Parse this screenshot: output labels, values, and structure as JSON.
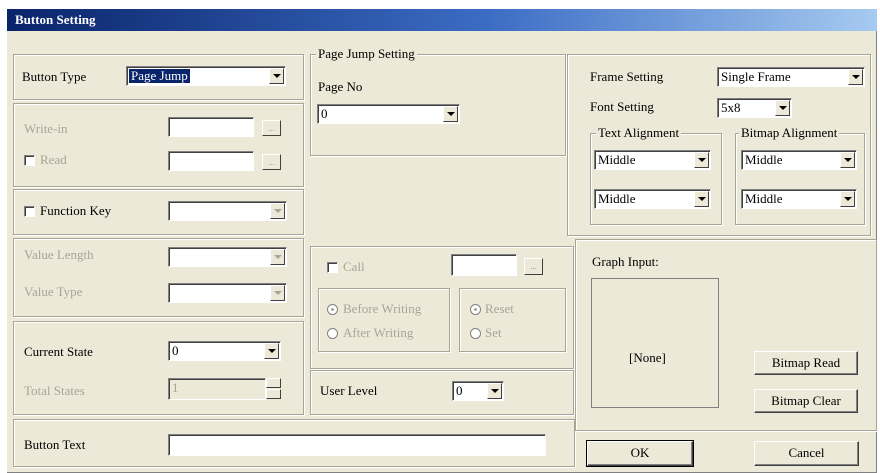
{
  "window": {
    "title": "Button Setting"
  },
  "button_type": {
    "label": "Button Type",
    "value": "Page Jump"
  },
  "page_jump": {
    "legend": "Page Jump Setting",
    "page_no_label": "Page No",
    "page_no_value": "0"
  },
  "write_in": {
    "label": "Write-in",
    "read_label": "Read",
    "ellipsis": "..."
  },
  "function_key": {
    "label": "Function Key"
  },
  "value": {
    "length_label": "Value Length",
    "type_label": "Value Type"
  },
  "call": {
    "label": "Call",
    "ellipsis": "...",
    "before_writing": "Before Writing",
    "after_writing": "After Writing",
    "reset": "Reset",
    "set": "Set"
  },
  "state": {
    "current_label": "Current State",
    "current_value": "0",
    "total_label": "Total States",
    "total_value": "1"
  },
  "user_level": {
    "label": "User Level",
    "value": "0"
  },
  "button_text": {
    "label": "Button Text",
    "value": ""
  },
  "frame": {
    "label": "Frame Setting",
    "value": "Single Frame"
  },
  "font": {
    "label": "Font Setting",
    "value": "5x8"
  },
  "text_alignment": {
    "legend": "Text Alignment",
    "horizontal": "Middle",
    "vertical": "Middle"
  },
  "bitmap_alignment": {
    "legend": "Bitmap Alignment",
    "horizontal": "Middle",
    "vertical": "Middle"
  },
  "graph_input": {
    "label": "Graph Input:",
    "preview": "[None]",
    "read_button": "Bitmap Read",
    "clear_button": "Bitmap Clear"
  },
  "actions": {
    "ok": "OK",
    "cancel": "Cancel"
  }
}
